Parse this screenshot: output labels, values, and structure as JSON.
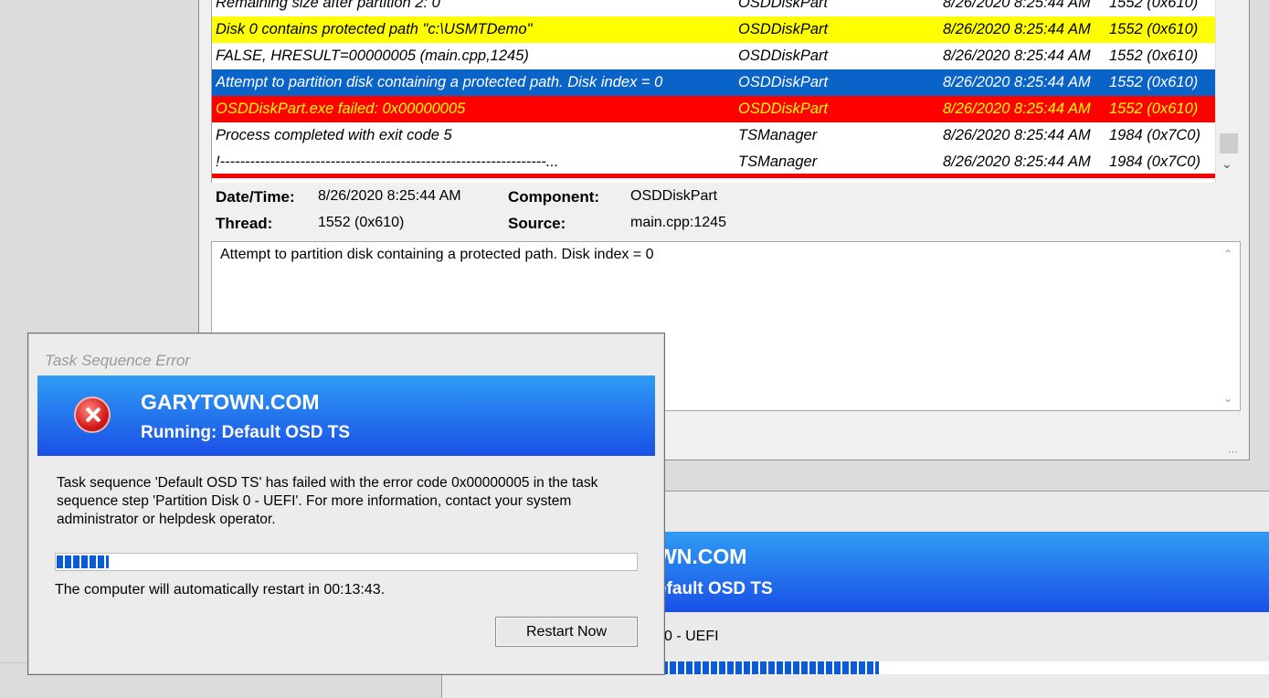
{
  "log": {
    "rows": [
      {
        "message": "Remaining size after partition 2: 0",
        "component": "OSDDiskPart",
        "datetime": "8/26/2020 8:25:44 AM",
        "thread": "1552 (0x610)",
        "style": "normal"
      },
      {
        "message": "Disk 0 contains protected path \"c:\\USMTDemo\"",
        "component": "OSDDiskPart",
        "datetime": "8/26/2020 8:25:44 AM",
        "thread": "1552 (0x610)",
        "style": "yellow"
      },
      {
        "message": "FALSE, HRESULT=00000005 (main.cpp,1245)",
        "component": "OSDDiskPart",
        "datetime": "8/26/2020 8:25:44 AM",
        "thread": "1552 (0x610)",
        "style": "normal"
      },
      {
        "message": "Attempt to partition disk containing a protected path.  Disk index = 0",
        "component": "OSDDiskPart",
        "datetime": "8/26/2020 8:25:44 AM",
        "thread": "1552 (0x610)",
        "style": "selected"
      },
      {
        "message": "OSDDiskPart.exe failed: 0x00000005",
        "component": "OSDDiskPart",
        "datetime": "8/26/2020 8:25:44 AM",
        "thread": "1552 (0x610)",
        "style": "error"
      },
      {
        "message": "Process completed with exit code 5",
        "component": "TSManager",
        "datetime": "8/26/2020 8:25:44 AM",
        "thread": "1984 (0x7C0)",
        "style": "normal"
      },
      {
        "message": "!-----------------------------------------------------------------...",
        "component": "TSManager",
        "datetime": "8/26/2020 8:25:44 AM",
        "thread": "1984 (0x7C0)",
        "style": "normal"
      }
    ],
    "details": {
      "datetime_label": "Date/Time:",
      "datetime_value": "8/26/2020 8:25:44 AM",
      "component_label": "Component:",
      "component_value": "OSDDiskPart",
      "thread_label": "Thread:",
      "thread_value": "1552 (0x610)",
      "source_label": "Source:",
      "source_value": "main.cpp:1245"
    },
    "message_text": "Attempt to partition disk containing a protected path.  Disk index = 0",
    "icons": {
      "scroll_down": "chevron-down-icon",
      "scroll_up": "chevron-up-icon",
      "resize_grip": "grip-icon"
    }
  },
  "bg_dialog": {
    "org_partial": "WN.COM",
    "running_partial": "efault OSD TS",
    "step_partial": "0 - UEFI",
    "progress_percent": 34
  },
  "error_dialog": {
    "title": "Task Sequence Error",
    "org": "GARYTOWN.COM",
    "running": "Running: Default OSD TS",
    "message": "Task sequence 'Default OSD TS' has failed with the error code 0x00000005 in the task sequence step 'Partition Disk 0 - UEFI'. For more information, contact your system administrator or helpdesk operator.",
    "progress_percent": 9,
    "restart_text": "The computer will automatically restart in 00:13:43.",
    "restart_button": "Restart Now",
    "icon": "error-icon"
  },
  "colors": {
    "banner_top": "#2f9cf4",
    "banner_bottom": "#1a50e6",
    "row_yellow": "#ffff00",
    "row_selected": "#0a64c8",
    "row_error": "#ff0000",
    "error_text": "#ffff00",
    "progress_fill": "#0a5bd8"
  }
}
